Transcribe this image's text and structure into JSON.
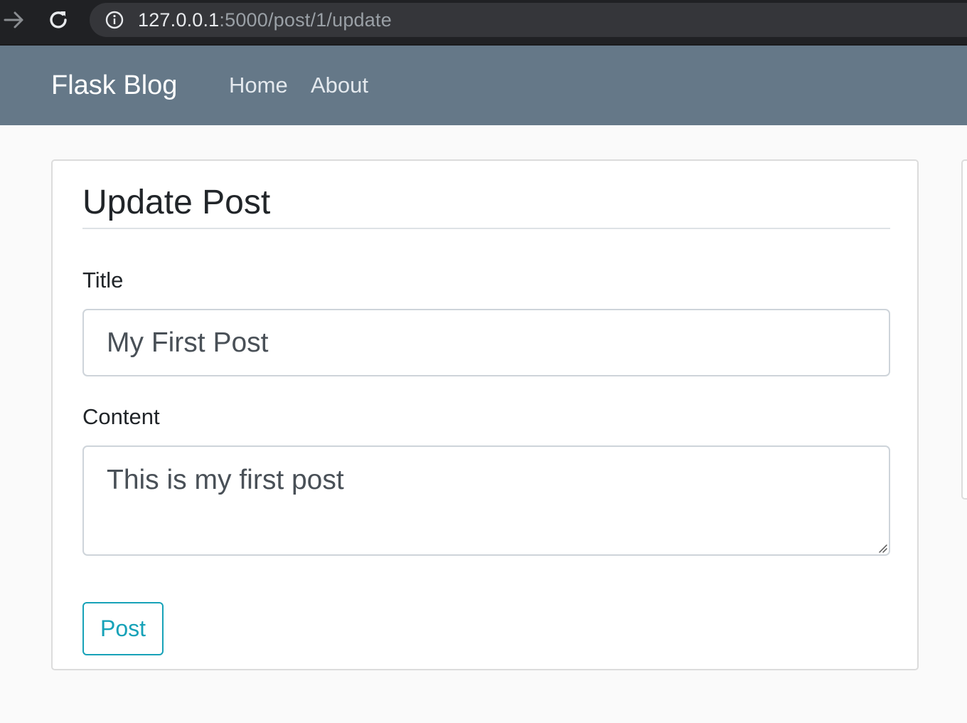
{
  "browser": {
    "url_host": "127.0.0.1",
    "url_path": ":5000/post/1/update",
    "back_icon": "arrow-right-icon",
    "reload_icon": "reload-icon",
    "info_icon": "info-icon"
  },
  "navbar": {
    "brand": "Flask Blog",
    "links": [
      {
        "label": "Home"
      },
      {
        "label": "About"
      }
    ],
    "background": "#657888"
  },
  "form": {
    "legend": "Update Post",
    "title_label": "Title",
    "title_value": "My First Post",
    "content_label": "Content",
    "content_value": "This is my first post",
    "submit_label": "Post",
    "accent": "#17a2b8"
  }
}
